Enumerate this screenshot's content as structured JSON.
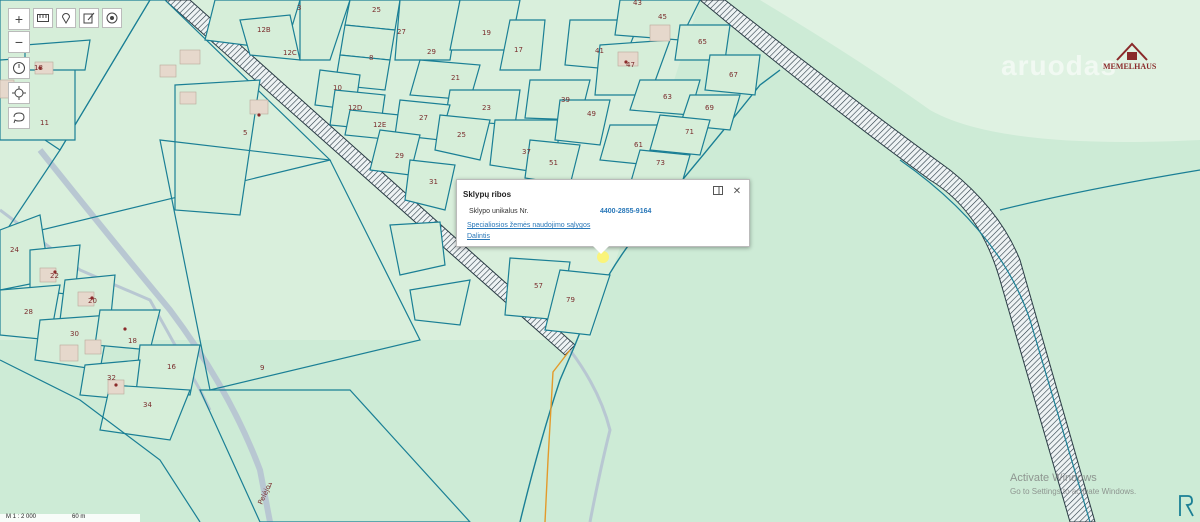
{
  "popup": {
    "title": "Sklypų ribos",
    "field_label": "Sklypo unikalus Nr.",
    "field_value": "4400-2855-9164",
    "link_special": "Specialiosios žemės naudojimo sąlygos",
    "link_share": "Dalintis"
  },
  "brand": {
    "logo_text": "MEMELHAUS",
    "watermark": "aruodas"
  },
  "overlay": {
    "activate_title": "Activate Windows",
    "activate_sub": "Go to Settings to activate Windows."
  },
  "scale": {
    "ratio": "M 1 : 2 000",
    "distance": "60 m"
  },
  "road_label": "Pelėjo",
  "plots": [
    "3",
    "25",
    "12B",
    "12C",
    "27",
    "29",
    "19",
    "17",
    "8",
    "10",
    "12D",
    "12E",
    "21",
    "23",
    "27",
    "25",
    "29",
    "31",
    "37",
    "39",
    "49",
    "51",
    "41",
    "47",
    "45",
    "43",
    "63",
    "65",
    "67",
    "69",
    "61",
    "71",
    "73",
    "57",
    "79",
    "18",
    "11",
    "5",
    "24",
    "22",
    "20",
    "28",
    "30",
    "18",
    "16",
    "32",
    "34",
    "9",
    "7"
  ],
  "colors": {
    "water_stroke": "#1a7f95",
    "plot_fill": "#d6eed9",
    "label": "#7a2d2d",
    "road": "#b8c7d2"
  }
}
